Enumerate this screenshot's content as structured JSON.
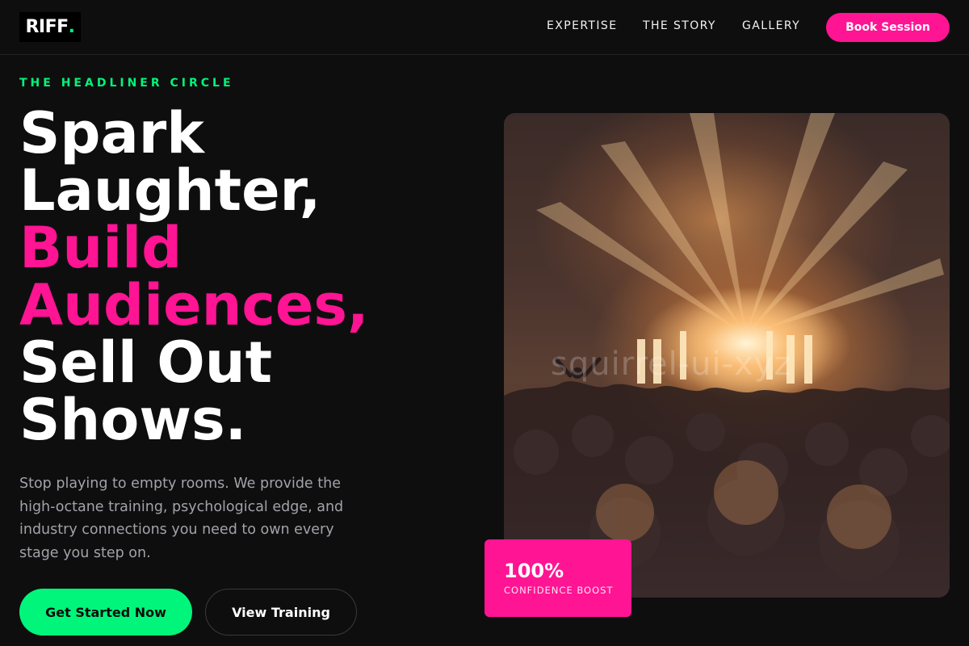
{
  "nav": {
    "logo_text": "RIFF",
    "logo_dot": ".",
    "links": [
      "EXPERTISE",
      "THE STORY",
      "GALLERY"
    ],
    "cta_label": "Book Session"
  },
  "hero": {
    "eyebrow": "THE HEADLINER CIRCLE",
    "headline_lines": [
      {
        "text": "Spark",
        "accent": false
      },
      {
        "text": "Laughter,",
        "accent": false
      },
      {
        "text": "Build",
        "accent": true
      },
      {
        "text": "Audiences,",
        "accent": true
      },
      {
        "text": "Sell Out",
        "accent": false
      },
      {
        "text": "Shows.",
        "accent": false
      }
    ],
    "description": "Stop playing to empty rooms. We provide the high-octane training, psychological edge, and industry connections you need to own every stage you step on.",
    "primary_cta": "Get Started Now",
    "secondary_cta": "View Training"
  },
  "image": {
    "subject": "concert-crowd-photo",
    "watermark": "squirrel-ui-xyz"
  },
  "stat": {
    "value": "100%",
    "label": "CONFIDENCE BOOST"
  },
  "colors": {
    "background": "#0e0e0f",
    "accent_pink": "#ff1493",
    "accent_green": "#00f57a",
    "muted_text": "#a2a2a8"
  }
}
